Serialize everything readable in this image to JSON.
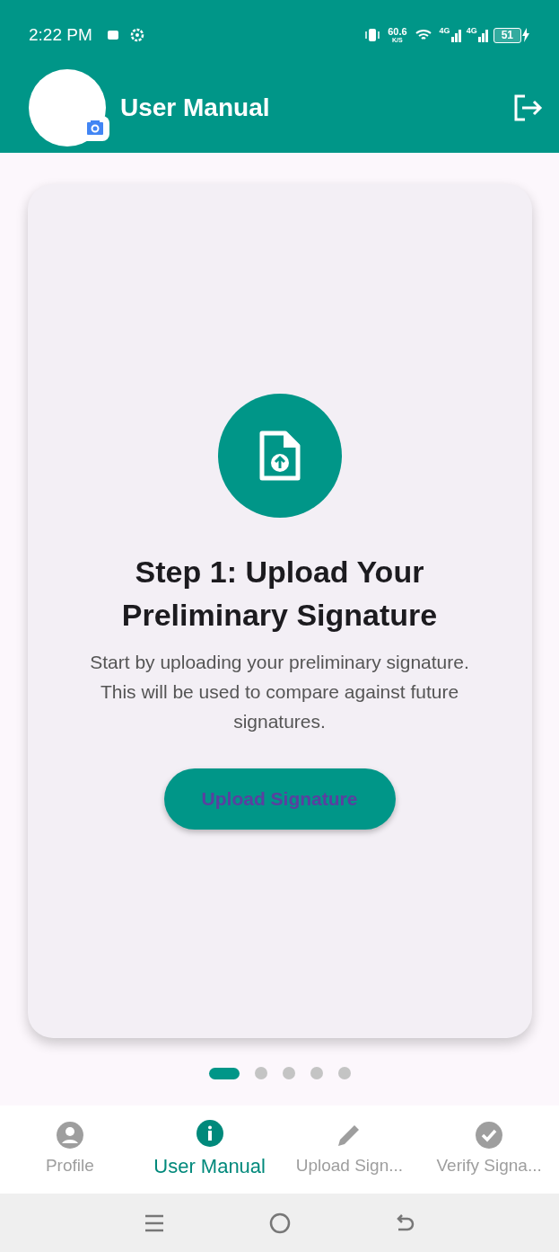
{
  "status_bar": {
    "time": "2:22 PM",
    "speed": "60.6",
    "speed_unit": "K/S",
    "network_1": "4G",
    "network_2": "4G",
    "battery": "51"
  },
  "app_bar": {
    "title": "User Manual"
  },
  "step": {
    "title": "Step 1: Upload Your Preliminary Signature",
    "description": "Start by uploading your preliminary signature. This will be used to compare against future signatures.",
    "button": "Upload Signature"
  },
  "pager": [
    {
      "selected": true
    },
    {
      "selected": false
    },
    {
      "selected": false
    },
    {
      "selected": false
    },
    {
      "selected": false
    }
  ],
  "bottom_nav": [
    {
      "kind": "profile",
      "label": "Profile",
      "selected": false
    },
    {
      "kind": "info",
      "label": "User Manual",
      "selected": true
    },
    {
      "kind": "pencil",
      "label": "Upload Sign...",
      "selected": false
    },
    {
      "kind": "check",
      "label": "Verify Signa...",
      "selected": false
    }
  ]
}
